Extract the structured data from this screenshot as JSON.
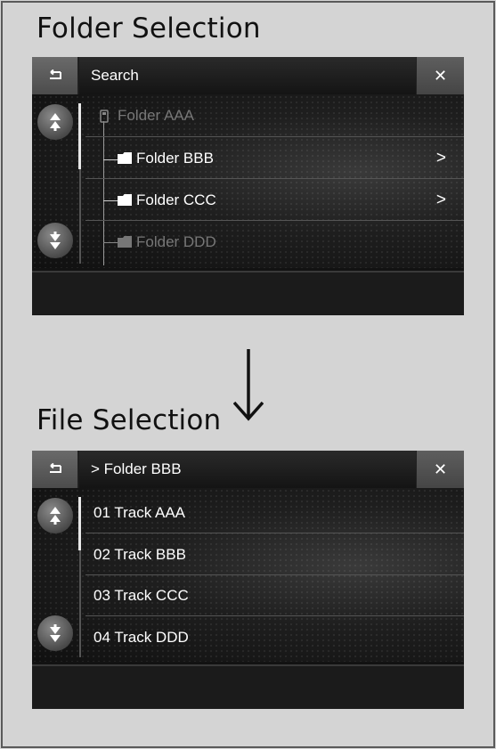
{
  "headings": {
    "folder_selection": "Folder Selection",
    "file_selection": "File Selection"
  },
  "folder_screen": {
    "title": "Search",
    "back_icon": "back-arrow-icon",
    "close_icon": "close-icon",
    "close_label": "✕",
    "root": "Folder AAA",
    "items": [
      {
        "label": "Folder BBB",
        "chevron": ">"
      },
      {
        "label": "Folder CCC",
        "chevron": ">"
      },
      {
        "label": "Folder DDD",
        "chevron": ""
      }
    ]
  },
  "file_screen": {
    "title": "> Folder BBB",
    "back_icon": "back-arrow-icon",
    "close_icon": "close-icon",
    "close_label": "✕",
    "items": [
      {
        "label": "01 Track AAA"
      },
      {
        "label": "02 Track BBB"
      },
      {
        "label": "03 Track CCC"
      },
      {
        "label": "04 Track DDD"
      }
    ]
  },
  "colors": {
    "page_bg": "#d4d4d4",
    "screen_bg": "#121212",
    "text": "#ffffff",
    "dim_text": "#777777"
  }
}
